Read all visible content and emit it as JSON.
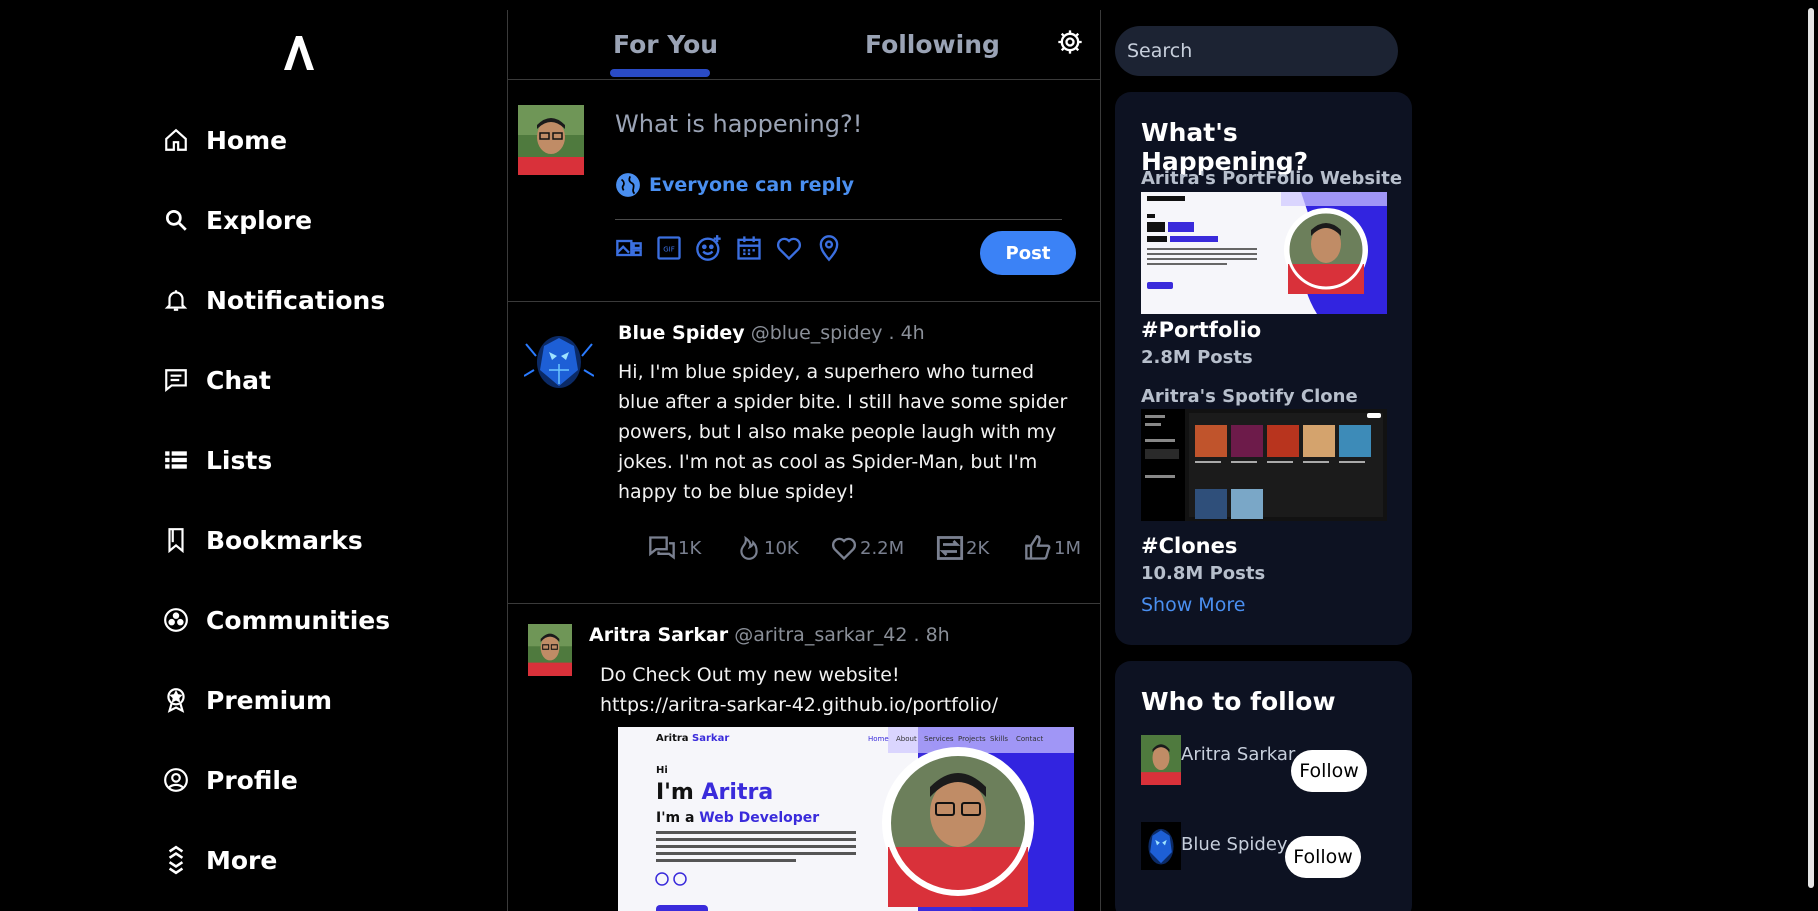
{
  "nav": {
    "items": [
      {
        "label": "Home",
        "icon": "home-icon"
      },
      {
        "label": "Explore",
        "icon": "search-icon"
      },
      {
        "label": "Notifications",
        "icon": "bell-icon"
      },
      {
        "label": "Chat",
        "icon": "chat-icon"
      },
      {
        "label": "Lists",
        "icon": "list-icon"
      },
      {
        "label": "Bookmarks",
        "icon": "bookmark-icon"
      },
      {
        "label": "Communities",
        "icon": "communities-icon"
      },
      {
        "label": "Premium",
        "icon": "premium-icon"
      },
      {
        "label": "Profile",
        "icon": "profile-icon"
      },
      {
        "label": "More",
        "icon": "more-icon"
      }
    ]
  },
  "tabs": {
    "for_you": "For You",
    "following": "Following"
  },
  "composer": {
    "placeholder": "What is happening?!",
    "reply_setting": "Everyone can reply",
    "post_label": "Post"
  },
  "tweets": [
    {
      "name": "Blue Spidey",
      "handle": "@blue_spidey",
      "time": ". 4h",
      "text": "Hi, I'm blue spidey, a superhero who turned blue after a spider bite. I still have some spider powers, but I also make people laugh with my jokes. I'm not as cool as Spider-Man, but I'm happy to be blue spidey!",
      "stats": {
        "replies": "1K",
        "views": "10K",
        "likes": "2.2M",
        "retweets": "2K",
        "upvotes": "1M"
      }
    },
    {
      "name": "Aritra Sarkar",
      "handle": "@aritra_sarkar_42",
      "time": ". 8h",
      "line1": "Do Check Out my new website!",
      "line2": "https://aritra-sarkar-42.github.io/portfolio/",
      "preview": {
        "brand_first": "Aritra",
        "brand_second": "Sarkar",
        "nav": [
          "Home",
          "About",
          "Services",
          "Projects",
          "Skills",
          "Contact"
        ],
        "hi": "Hi",
        "im": "I'm",
        "im_name": "Aritra",
        "im_a": "I'm a",
        "role": "Web Developer"
      }
    }
  ],
  "search": {
    "placeholder": "Search"
  },
  "happening": {
    "title": "What's Happening?",
    "trends": [
      {
        "title": "Aritra's PortFolio Website",
        "tag": "#Portfolio",
        "count": "2.8M Posts"
      },
      {
        "title": "Aritra's Spotify Clone",
        "tag": "#Clones",
        "count": "10.8M Posts"
      }
    ],
    "show_more": "Show More"
  },
  "who_to_follow": {
    "title": "Who to follow",
    "users": [
      {
        "name": "Aritra Sarkar",
        "button": "Follow"
      },
      {
        "name": "Blue Spidey",
        "button": "Follow"
      }
    ]
  },
  "colors": {
    "accent": "#3b82f6",
    "link": "#4a8ff0",
    "panel": "#0d1222",
    "search_bg": "#1c2333"
  }
}
